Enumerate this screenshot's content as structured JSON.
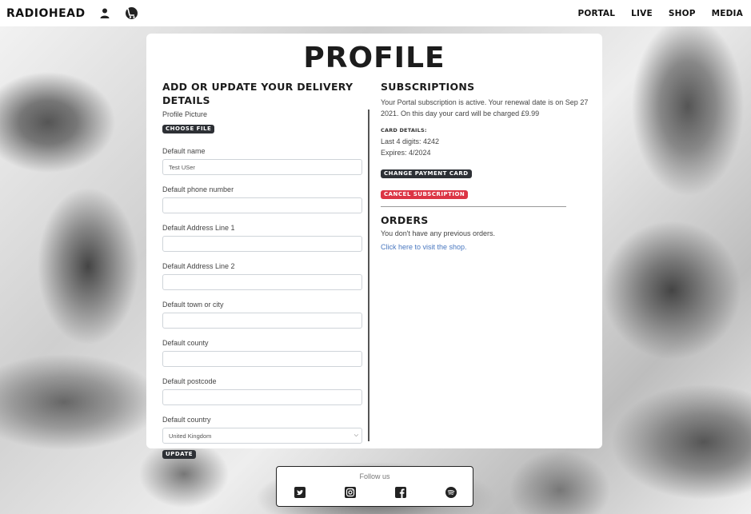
{
  "header": {
    "brand": "RADIOHEAD",
    "nav": [
      "PORTAL",
      "LIVE",
      "SHOP",
      "MEDIA"
    ],
    "icons": [
      "user-icon",
      "cart-icon"
    ]
  },
  "page": {
    "title": "PROFILE"
  },
  "delivery": {
    "heading": "ADD OR UPDATE YOUR DELIVERY DETAILS",
    "profile_picture_label": "Profile Picture",
    "choose_file_label": "CHOOSE FILE",
    "fields": {
      "name": {
        "label": "Default name",
        "value": "Test USer"
      },
      "phone": {
        "label": "Default phone number",
        "value": ""
      },
      "address1": {
        "label": "Default Address Line 1",
        "value": ""
      },
      "address2": {
        "label": "Default Address Line 2",
        "value": ""
      },
      "town": {
        "label": "Default town or city",
        "value": ""
      },
      "county": {
        "label": "Default county",
        "value": ""
      },
      "postcode": {
        "label": "Default postcode",
        "value": ""
      },
      "country": {
        "label": "Default country",
        "value": "United Kingdom"
      }
    },
    "update_label": "UPDATE"
  },
  "subscriptions": {
    "heading": "SUBSCRIPTIONS",
    "status_text": "Your Portal subscription is active. Your renewal date is on Sep 27 2021. On this day your card will be charged £9.99",
    "card_details_heading": "CARD DETAILS:",
    "last4": "Last 4 digits: 4242",
    "expires": "Expires: 4/2024",
    "change_card_label": "CHANGE PAYMENT CARD",
    "cancel_label": "CANCEL SUBSCRIPTION"
  },
  "orders": {
    "heading": "ORDERS",
    "empty_text": "You don't have any previous orders.",
    "shop_link": "Click here to visit the shop."
  },
  "footer": {
    "follow_label": "Follow us",
    "social": [
      "twitter-icon",
      "instagram-icon",
      "facebook-icon",
      "spotify-icon"
    ]
  },
  "colors": {
    "accent_red": "#dc3545",
    "dark_button": "#2d3035",
    "link": "#4a78c0"
  }
}
